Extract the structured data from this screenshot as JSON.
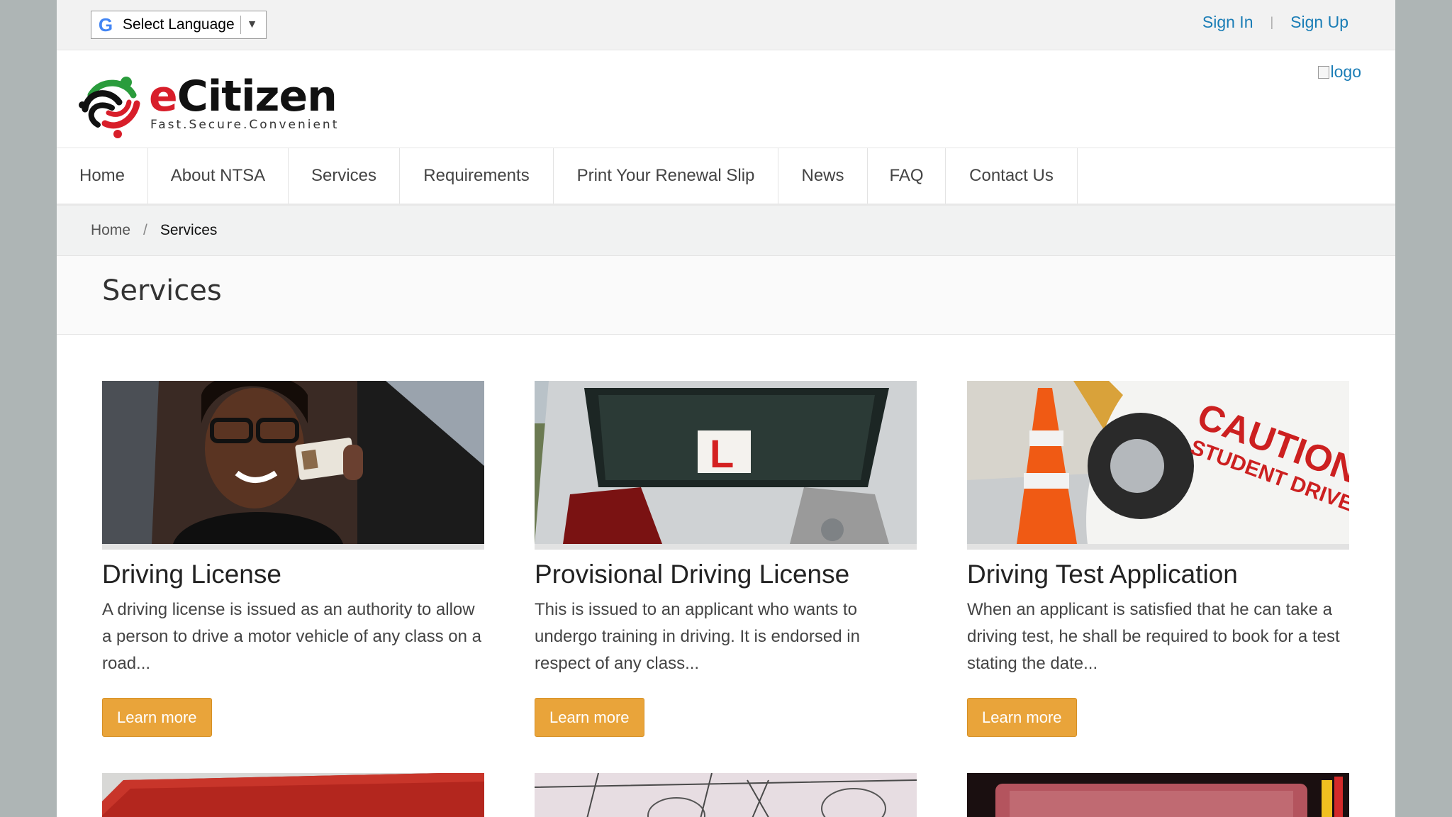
{
  "topbar": {
    "language_label": "Select Language",
    "sign_in": "Sign In",
    "sign_up": "Sign Up"
  },
  "header": {
    "brand_e": "e",
    "brand_rest": "Citizen",
    "tagline": "Fast.Secure.Convenient",
    "right_logo_alt": "logo"
  },
  "nav": {
    "items": [
      {
        "label": "Home"
      },
      {
        "label": "About NTSA"
      },
      {
        "label": "Services"
      },
      {
        "label": "Requirements"
      },
      {
        "label": "Print Your Renewal Slip"
      },
      {
        "label": "News"
      },
      {
        "label": "FAQ"
      },
      {
        "label": "Contact Us"
      }
    ]
  },
  "breadcrumb": {
    "home": "Home",
    "separator": "/",
    "current": "Services"
  },
  "page_title": "Services",
  "cards": [
    {
      "title": "Driving License",
      "text": "A driving license is issued as an authority to allow a person to drive a motor vehicle of any class on a road...",
      "button": "Learn more"
    },
    {
      "title": "Provisional Driving License",
      "text": "This is issued to an applicant who wants to undergo training in driving. It is endorsed in respect of any class...",
      "button": "Learn more",
      "plate": "L"
    },
    {
      "title": "Driving Test Application",
      "text": "When an applicant is satisfied that he can take a driving test, he shall be required to book for a test stating the date...",
      "button": "Learn more",
      "sign_line1": "CAUTION",
      "sign_line2": "STUDENT DRIVER"
    }
  ],
  "colors": {
    "accent_button": "#e9a43a",
    "link": "#1a7db6",
    "brand_red": "#d81e2a"
  }
}
